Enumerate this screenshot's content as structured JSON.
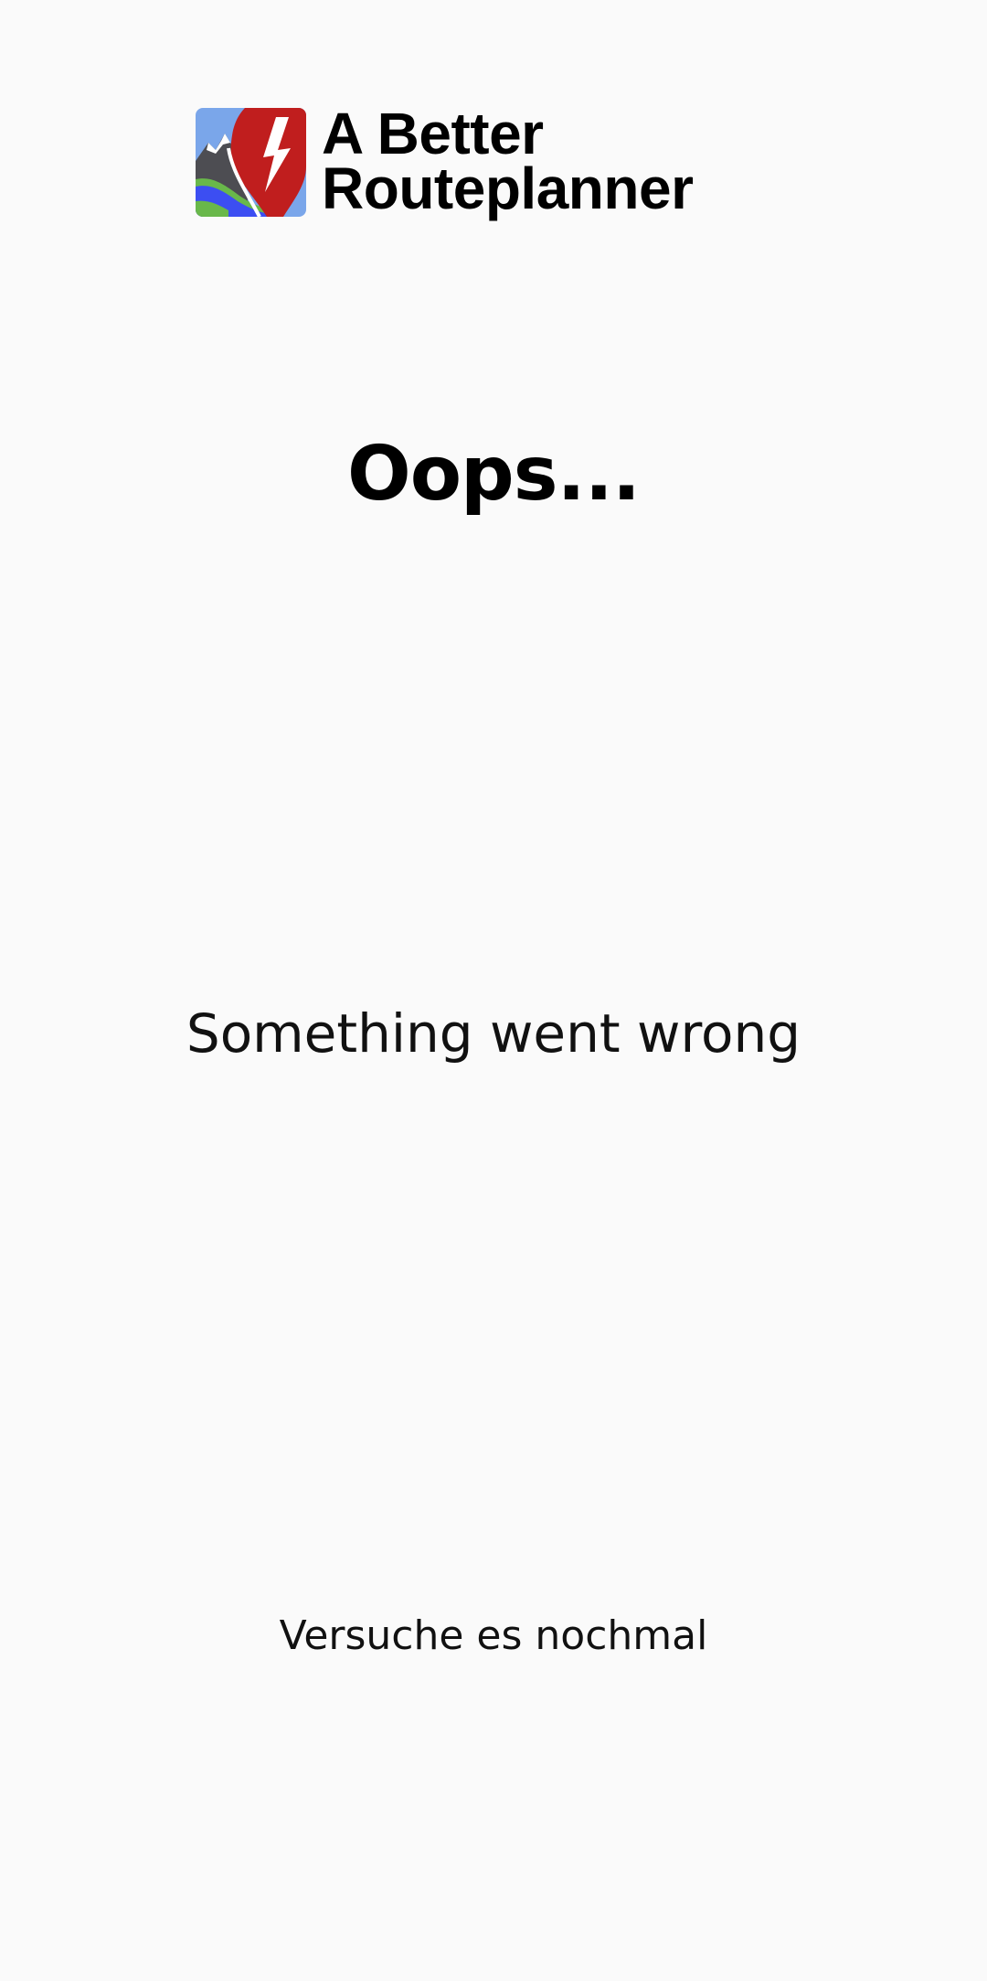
{
  "brand": {
    "name_line1": "A Better",
    "name_line2": "Routeplanner",
    "logo_icon": "abrp-logo-icon",
    "colors": {
      "red": "#c01e1e",
      "sky": "#7aa6ea",
      "mountain": "#4d4d52",
      "snow": "#ffffff",
      "water": "#3c4ef2",
      "grass": "#69b84a"
    }
  },
  "error": {
    "title": "Oops...",
    "message": "Something went wrong",
    "retry_label": "Versuche es nochmal"
  },
  "colors": {
    "background": "#fafafa",
    "text": "#111111"
  }
}
